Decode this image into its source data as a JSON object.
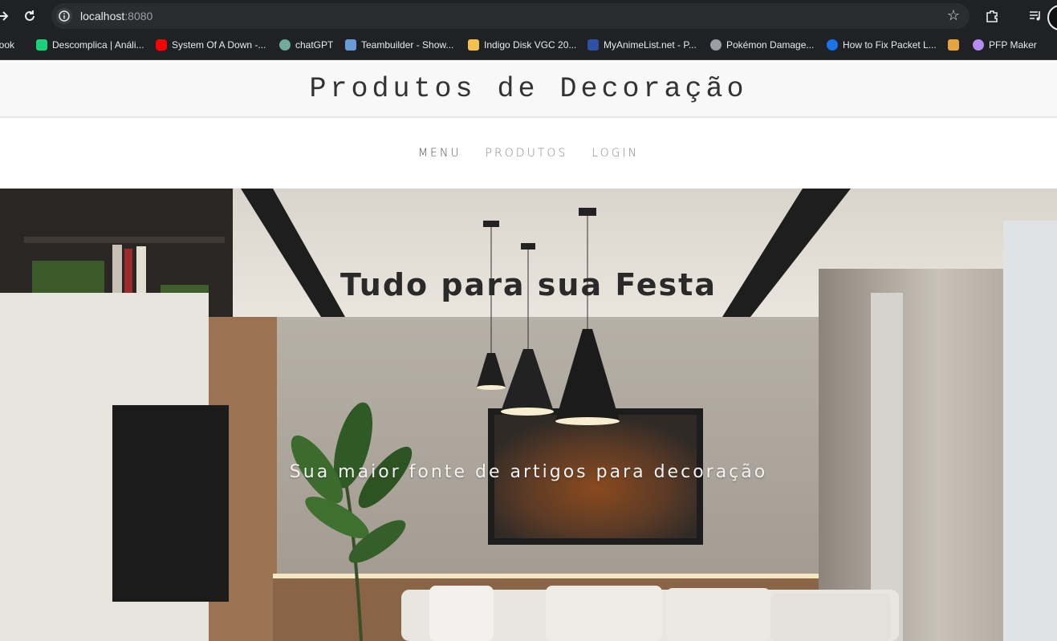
{
  "browser": {
    "url_host": "localhost",
    "url_port": ":8080",
    "bookmarks": [
      {
        "label": "book",
        "color": "#3b5998"
      },
      {
        "label": "Descomplica | Análi...",
        "color": "#17d27a"
      },
      {
        "label": "System Of A Down -...",
        "color": "#ff0000"
      },
      {
        "label": "chatGPT",
        "color": "#74aa9c"
      },
      {
        "label": "Teambuilder - Show...",
        "color": "#6a9bd8"
      },
      {
        "label": "Indigo Disk VGC 20...",
        "color": "#f2c14e"
      },
      {
        "label": "MyAnimeList.net - P...",
        "color": "#2e51a2"
      },
      {
        "label": "Pokémon Damage...",
        "color": "#9aa0a6"
      },
      {
        "label": "How to Fix Packet L...",
        "color": "#1a73e8"
      },
      {
        "label": "",
        "color": "#e8a33d"
      },
      {
        "label": "PFP Maker",
        "color": "#b58cf0"
      }
    ]
  },
  "site": {
    "title": "Produtos de Decoração",
    "nav": [
      "MENU",
      "PRODUTOS",
      "LOGIN"
    ]
  },
  "hero": {
    "title": "Tudo para sua Festa",
    "subtitle": "Sua maior fonte de artigos para decoração"
  }
}
